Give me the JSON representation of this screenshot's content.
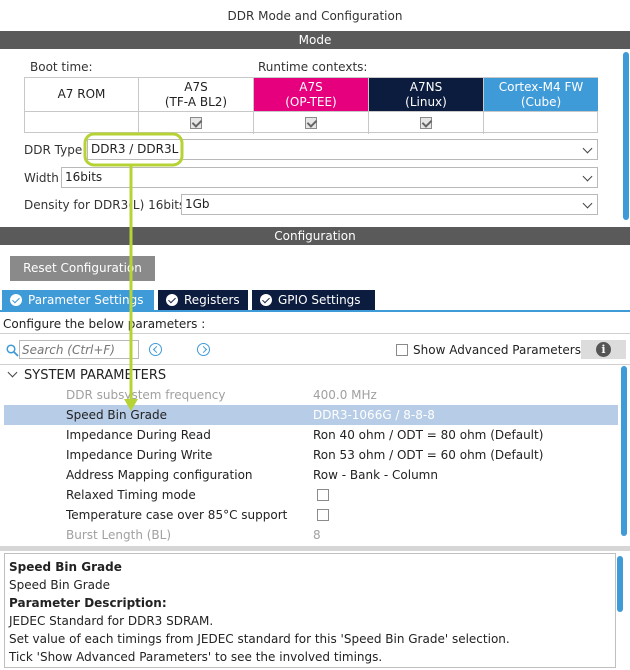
{
  "window": {
    "title": "DDR Mode and Configuration"
  },
  "mode_section": {
    "title": "Mode",
    "boot_time_label": "Boot time:",
    "runtime_contexts_label": "Runtime contexts:",
    "contexts": [
      {
        "line1": "A7 ROM",
        "line2": "",
        "checked": false,
        "has_check": false,
        "bg": "#ffffff",
        "fg": "#222222"
      },
      {
        "line1": "A7S",
        "line2": "(TF-A BL2)",
        "checked": true,
        "has_check": true,
        "bg": "#ffffff",
        "fg": "#222222"
      },
      {
        "line1": "A7S",
        "line2": "(OP-TEE)",
        "checked": true,
        "has_check": true,
        "bg": "#e6007e",
        "fg": "#ffffff"
      },
      {
        "line1": "A7NS",
        "line2": "(Linux)",
        "checked": true,
        "has_check": true,
        "bg": "#0c1c3e",
        "fg": "#ffffff"
      },
      {
        "line1": "Cortex-M4 FW",
        "line2": "(Cube)",
        "checked": false,
        "has_check": false,
        "bg": "#3f9ad8",
        "fg": "#ffffff"
      }
    ],
    "ddr_type": {
      "label": "DDR Type",
      "value": "DDR3 / DDR3L"
    },
    "width": {
      "label": "Width",
      "value": "16bits"
    },
    "density": {
      "label": "Density for DDR3(L) 16bits",
      "value": "1Gb"
    }
  },
  "configuration_section": {
    "title": "Configuration",
    "reset_button": "Reset Configuration",
    "tabs": [
      {
        "label": "Parameter Settings",
        "active": true
      },
      {
        "label": "Registers",
        "active": false
      },
      {
        "label": "GPIO Settings",
        "active": false
      }
    ],
    "configure_text": "Configure the below parameters :",
    "search_placeholder": "Search (Ctrl+F)",
    "show_advanced_label": "Show Advanced Parameters",
    "group_title": "SYSTEM PARAMETERS",
    "params": [
      {
        "name": "DDR subsystem frequency",
        "value": "400.0 MHz",
        "disabled": true,
        "selected": false,
        "type": "text"
      },
      {
        "name": "Speed Bin Grade",
        "value": "DDR3-1066G / 8-8-8",
        "disabled": false,
        "selected": true,
        "type": "text"
      },
      {
        "name": "Impedance During Read",
        "value": "Ron 40 ohm / ODT = 80 ohm (Default)",
        "disabled": false,
        "selected": false,
        "type": "text"
      },
      {
        "name": "Impedance During Write",
        "value": "Ron 53 ohm / ODT = 60 ohm (Default)",
        "disabled": false,
        "selected": false,
        "type": "text"
      },
      {
        "name": "Address Mapping configuration",
        "value": "Row - Bank - Column",
        "disabled": false,
        "selected": false,
        "type": "text"
      },
      {
        "name": "Relaxed Timing mode",
        "value": "",
        "disabled": false,
        "selected": false,
        "type": "checkbox"
      },
      {
        "name": "Temperature case over 85°C support",
        "value": "",
        "disabled": false,
        "selected": false,
        "type": "checkbox"
      },
      {
        "name": "Burst Length (BL)",
        "value": "8",
        "disabled": true,
        "selected": false,
        "type": "text"
      }
    ],
    "description": {
      "title": "Speed Bin Grade",
      "subtitle": "Speed Bin Grade",
      "heading": "Parameter Description:",
      "lines": [
        "JEDEC Standard for DDR3 SDRAM.",
        "Set value of each timings from JEDEC standard for this 'Speed Bin Grade' selection.",
        "Tick 'Show Advanced Parameters' to see the involved timings."
      ]
    }
  },
  "colors": {
    "accent": "#3f9ad8",
    "annotation": "#b5d334",
    "section_bar": "#5a5a5a",
    "selected_row": "#b7cce6"
  },
  "icons": {
    "search": "search-icon",
    "prev": "previous-result-icon",
    "next": "next-result-icon",
    "info": "info-icon",
    "tab_check": "check-circle-icon",
    "collapse": "chevron-down-icon"
  }
}
